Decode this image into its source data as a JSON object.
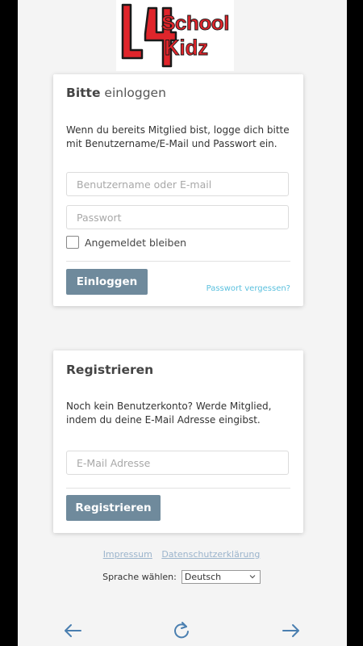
{
  "logo": {
    "text_top": "School",
    "text_bottom": "Kidz",
    "number": "4",
    "letter": "L",
    "colors": {
      "red": "#e0252b",
      "dark": "#1a1a1a"
    }
  },
  "login": {
    "title_bold": "Bitte",
    "title_light": "einloggen",
    "description": "Wenn du bereits Mitglied bist, logge dich bitte mit Benutzername/E-Mail und Passwort ein.",
    "username_placeholder": "Benutzername oder E-mail",
    "password_placeholder": "Passwort",
    "remember_label": "Angemeldet bleiben",
    "submit_label": "Einloggen",
    "forgot_label": "Passwort vergessen?"
  },
  "register": {
    "title": "Registrieren",
    "description": "Noch kein Benutzerkonto? Werde Mitglied, indem du deine E-Mail Adresse eingibst.",
    "email_placeholder": "E-Mail Adresse",
    "submit_label": "Registrieren"
  },
  "footer": {
    "imprint_label": "Impressum",
    "privacy_label": "Datenschutzerklärung",
    "language_label": "Sprache wählen:",
    "language_selected": "Deutsch"
  },
  "navbar": {
    "back_icon": "arrow-left-icon",
    "reload_icon": "reload-icon",
    "forward_icon": "arrow-right-icon"
  },
  "colors": {
    "button": "#6f8a9c",
    "link": "#5bc0de",
    "footer_link": "#9bb4cc",
    "nav_icon": "#4a7fb0"
  }
}
